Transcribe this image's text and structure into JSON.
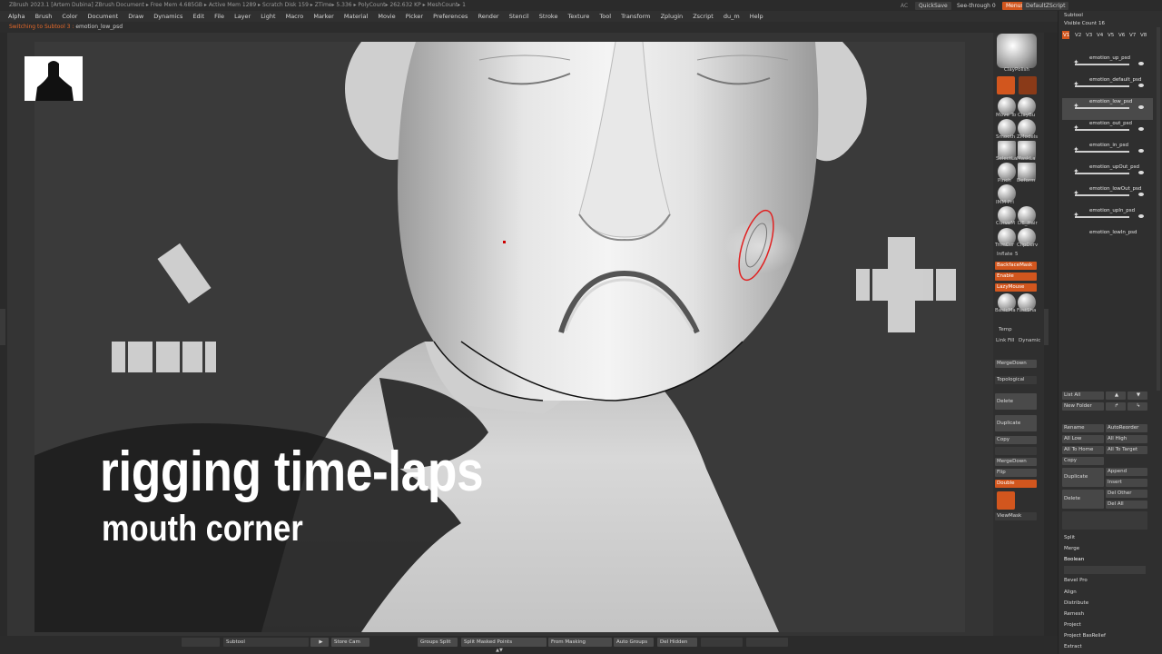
{
  "titlebar": {
    "text": "ZBrush 2023.1 [Artem Dubina]   ZBrush Document     ▸ Free Mem 4.685GB ▸ Active Mem 1289 ▸ Scratch Disk 159 ▸ ZTime▸ 5.336 ▸ PolyCount▸ 262.632 KP ▸ MeshCount▸ 1"
  },
  "topbar": {
    "ac": "AC",
    "quicksave": "QuickSave",
    "seethrough": "See-through  0",
    "menus": "Menus",
    "defaultzscript": "DefaultZScript"
  },
  "menubar": {
    "items": [
      "Alpha",
      "Brush",
      "Color",
      "Document",
      "Draw",
      "Dynamics",
      "Edit",
      "File",
      "Layer",
      "Light",
      "Macro",
      "Marker",
      "Material",
      "Movie",
      "Picker",
      "Preferences",
      "Render",
      "Stencil",
      "Stroke",
      "Texture",
      "Tool",
      "Transform",
      "Zplugin",
      "Zscript",
      "du_m",
      "Help"
    ]
  },
  "notebar": {
    "prefix": "Switching to Subtool 3 :",
    "subtool": "emotion_low_psd"
  },
  "caption": {
    "title": "rigging time-laps",
    "subtitle": "mouth corner"
  },
  "brushes": [
    {
      "label": "ClayPolish"
    },
    {
      "label": "Move To"
    },
    {
      "label": "ClayBu"
    },
    {
      "label": "Smooth"
    },
    {
      "label": "ZModels"
    },
    {
      "label": "SelectLa"
    },
    {
      "label": "MaskLa"
    },
    {
      "label": "Pinch"
    },
    {
      "label": "Deform"
    },
    {
      "label": "IMM Pri"
    },
    {
      "label": "CurveM"
    },
    {
      "label": "DE_Hair"
    },
    {
      "label": "TrimCur"
    },
    {
      "label": "ClipCurv"
    },
    {
      "label": "BasicMa"
    },
    {
      "label": "FastSha"
    }
  ],
  "midpanel": {
    "inflate_label": "Inflate",
    "inflate_value": "5",
    "backface_mask": "BackfaceMask",
    "enable": "Enable",
    "lazymouse": "LazyMouse",
    "temp": "Temp",
    "linkfill": "Link Fill",
    "dynamic": "Dynamic",
    "mergedown1": "MergeDown",
    "topological": "Topological",
    "delete": "Delete",
    "duplicate": "Duplicate",
    "copy": "Copy",
    "mergedown2": "MergeDown",
    "flip": "Flip",
    "double": "Double",
    "viewmask": "ViewMask"
  },
  "subtool_panel": {
    "title": "Subtool",
    "visible_count_label": "Visible Count",
    "visible_count": "16",
    "versions": [
      "V1",
      "V2",
      "V3",
      "V4",
      "V5",
      "V6",
      "V7",
      "V8"
    ],
    "items": [
      {
        "name": "emotion_up_psd"
      },
      {
        "name": "emotion_default_psd"
      },
      {
        "name": "emotion_low_psd"
      },
      {
        "name": "emotion_out_psd"
      },
      {
        "name": "emotion_in_psd"
      },
      {
        "name": "emotion_upOut_psd"
      },
      {
        "name": "emotion_lowOut_psd"
      },
      {
        "name": "emotion_upIn_psd"
      },
      {
        "name": "emotion_lowIn_psd"
      }
    ],
    "listall": "List All",
    "newfolder": "New Folder",
    "rename": "Rename",
    "autoreorder": "AutoReorder",
    "alllow": "All Low",
    "allhigh": "All High",
    "alltohome": "All To Home",
    "alltotarget": "All To Target",
    "copy": "Copy",
    "duplicate": "Duplicate",
    "append": "Append",
    "insert": "Insert",
    "delete": "Delete",
    "delother": "Del Other",
    "delall": "Del All",
    "split": "Split",
    "merge": "Merge",
    "boolean": "Boolean",
    "bevelpro": "Bevel Pro",
    "align": "Align",
    "distribute": "Distribute",
    "remesh": "Remesh",
    "project": "Project",
    "projectbasrelief": "Project BasRelief",
    "extract": "Extract"
  },
  "bottombar": {
    "subtool_label": "Subtool",
    "storecam": "Store Cam",
    "groupssplit": "Groups Split",
    "splitmasked": "Split Masked Points",
    "frommasking": "From Masking",
    "autogroups": "Auto Groups",
    "delhidden": "Del Hidden"
  }
}
